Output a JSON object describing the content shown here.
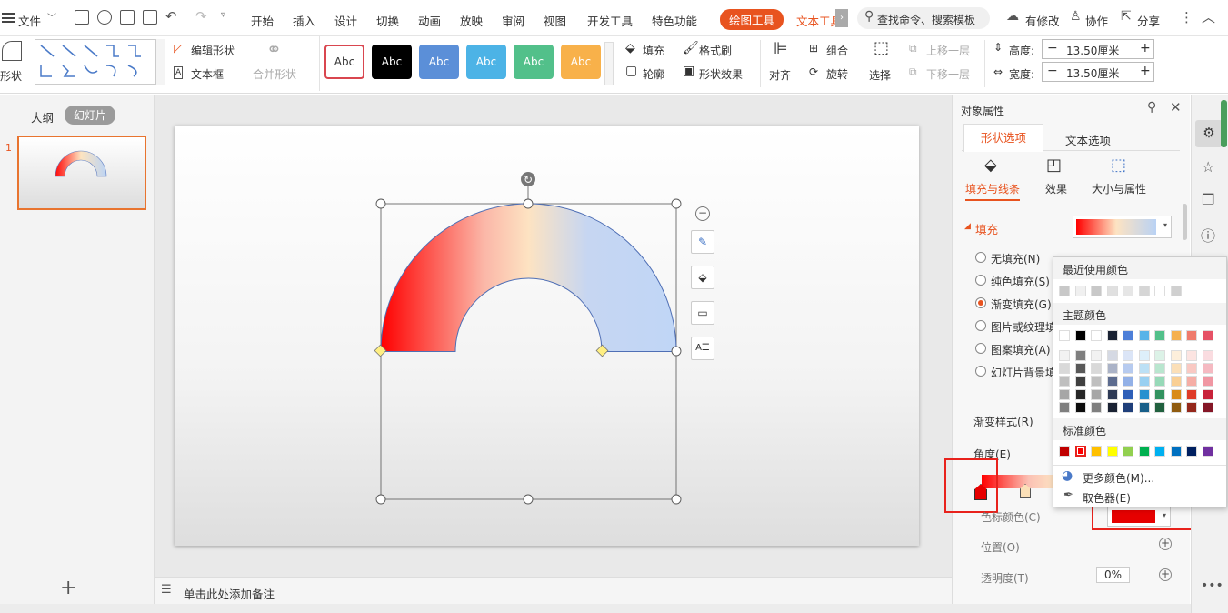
{
  "menubar": {
    "file": "文件",
    "tabs": [
      "开始",
      "插入",
      "设计",
      "切换",
      "动画",
      "放映",
      "审阅",
      "视图",
      "开发工具",
      "特色功能"
    ],
    "tab_drawing": "绘图工具",
    "tab_text": "文本工具",
    "search": "查找命令、搜索模板",
    "modified": "有修改",
    "collab": "协作",
    "share": "分享"
  },
  "ribbon": {
    "shape": "形状",
    "edit_shape": "编辑形状",
    "textbox": "文本框",
    "merge_shape": "合并形状",
    "style_label": "Abc",
    "fill": "填充",
    "outline": "轮廓",
    "format_painter": "格式刷",
    "shape_effect": "形状效果",
    "align": "对齐",
    "group": "组合",
    "rotate": "旋转",
    "select": "选择",
    "bring_forward": "上移一层",
    "send_backward": "下移一层",
    "height_label": "高度:",
    "height_value": "13.50厘米",
    "width_label": "宽度:",
    "width_value": "13.50厘米",
    "style_colors": [
      "#ffffff",
      "#000000",
      "#5b8fd8",
      "#4cb3e6",
      "#52c08a",
      "#f8b14a"
    ]
  },
  "leftpanel": {
    "outline": "大纲",
    "slides": "幻灯片",
    "slide_number": "1",
    "add": "+"
  },
  "notes": "单击此处添加备注",
  "pane": {
    "title": "对象属性",
    "tab_shape": "形状选项",
    "tab_text": "文本选项",
    "sub_fill_line": "填充与线条",
    "sub_effect": "效果",
    "sub_size": "大小与属性",
    "section_fill": "填充",
    "options": [
      "无填充(N)",
      "纯色填充(S)",
      "渐变填充(G)",
      "图片或纹理填",
      "图案填充(A)",
      "幻灯片背景填"
    ],
    "gradient_style": "渐变样式(R)",
    "angle": "角度(E)",
    "stop_color": "色标颜色(C)",
    "position": "位置(O)",
    "transparency": "透明度(T)",
    "percent": "0%"
  },
  "popup": {
    "recent": "最近使用颜色",
    "theme": "主题颜色",
    "standard": "标准颜色",
    "more_colors": "更多颜色(M)...",
    "picker": "取色器(E)"
  },
  "colors": {
    "recent": [
      "#c8c8c8",
      "#f0f0f0",
      "#c8c8c8",
      "#e0e0e0",
      "#e6e6e6",
      "#d6d6d6",
      "#ffffff",
      "#d0d0d0"
    ],
    "theme_top": [
      "#ffffff",
      "#000000",
      "#ffffff",
      "#1a2233",
      "#4d7fd8",
      "#58b3e8",
      "#52c08a",
      "#f5b04f",
      "#ef7b6c",
      "#e65266"
    ],
    "theme_cols": [
      [
        "#f2f2f2",
        "#d9d9d9",
        "#bfbfbf",
        "#a6a6a6",
        "#7f7f7f"
      ],
      [
        "#7f7f7f",
        "#595959",
        "#404040",
        "#262626",
        "#0d0d0d"
      ],
      [
        "#f2f2f2",
        "#d9d9d9",
        "#bfbfbf",
        "#a6a6a6",
        "#7f7f7f"
      ],
      [
        "#d5d9e3",
        "#abb3c7",
        "#5d6c8f",
        "#2e3a55",
        "#1a2233"
      ],
      [
        "#dbe5f7",
        "#b7cbef",
        "#93b1e7",
        "#2e5fb8",
        "#1f3f7a"
      ],
      [
        "#ddeffa",
        "#bce0f5",
        "#9ad0f1",
        "#2690cf",
        "#19608a"
      ],
      [
        "#dcf2e7",
        "#b9e6cf",
        "#97d9b8",
        "#32925f",
        "#21613f"
      ],
      [
        "#fdefdb",
        "#fbdfb8",
        "#f9cf95",
        "#d98b18",
        "#905c10"
      ],
      [
        "#fce4e1",
        "#f9c9c3",
        "#f5aea6",
        "#de3b28",
        "#94271b"
      ],
      [
        "#fadce0",
        "#f5bac2",
        "#f097a3",
        "#c8223a",
        "#851727"
      ]
    ],
    "standard": [
      "#c00000",
      "#ff0000",
      "#ffc000",
      "#ffff00",
      "#92d050",
      "#00b050",
      "#00b0f0",
      "#0070c0",
      "#002060",
      "#7030a0"
    ],
    "accent": "#e8531f"
  }
}
